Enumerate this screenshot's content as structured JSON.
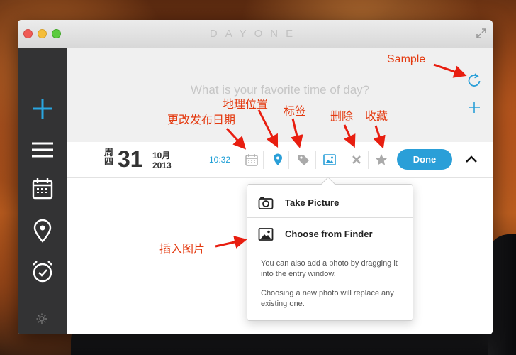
{
  "window": {
    "title": "DAYONE"
  },
  "prompt": {
    "question": "What is your favorite time of day?"
  },
  "entry": {
    "weekday": "周四",
    "day": "31",
    "month": "10月",
    "year": "2013",
    "time": "10:32"
  },
  "toolbar": {
    "done_label": "Done"
  },
  "popover": {
    "take_picture": "Take Picture",
    "choose_finder": "Choose from Finder",
    "help_1": "You can also add a photo by dragging it into the entry window.",
    "help_2": "Choosing a new photo will replace any existing one."
  },
  "annotations": {
    "sample": "Sample",
    "change_date": "更改发布日期",
    "location": "地理位置",
    "tags": "标签",
    "delete": "删除",
    "favorite": "收藏",
    "insert_photo": "插入图片"
  },
  "colors": {
    "accent": "#2a9fd8",
    "annotation": "#e43a10",
    "sidebar": "#333334"
  },
  "icons": {
    "sidebar": [
      "plus-icon",
      "menu-icon",
      "calendar-icon",
      "location-pin-icon",
      "alarm-clock-icon",
      "gear-icon"
    ],
    "toolbar": [
      "calendar-icon",
      "location-pin-icon",
      "tag-icon",
      "photo-icon",
      "close-icon",
      "star-icon",
      "chevron-up-icon"
    ]
  }
}
